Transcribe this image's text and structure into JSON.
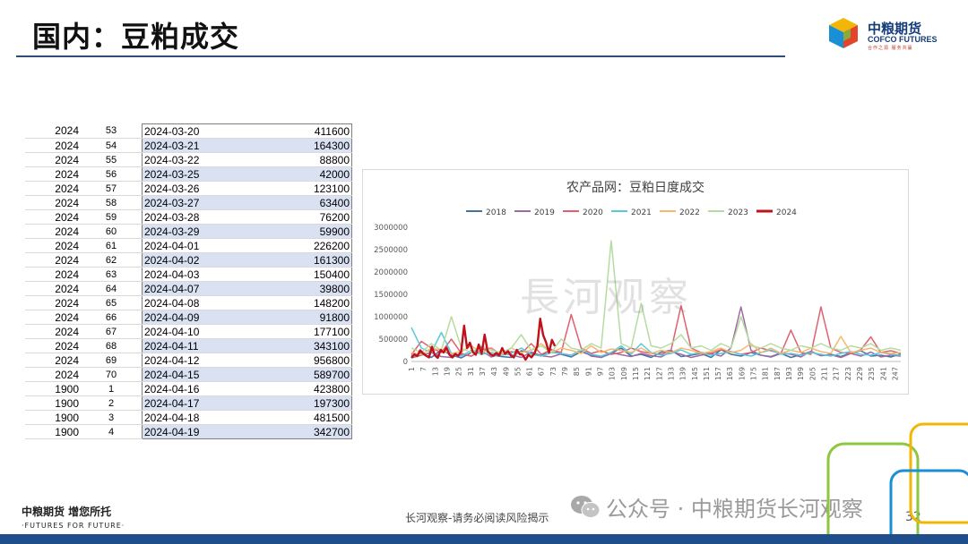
{
  "slide": {
    "title": "国内：豆粕成交",
    "page_number": "32"
  },
  "logo": {
    "cn": "中粮期货",
    "en": "COFCO FUTURES",
    "sub": "合作之源 服务共赢"
  },
  "table": {
    "rows": [
      [
        "2024",
        "53",
        "2024-03-20",
        "411600"
      ],
      [
        "2024",
        "54",
        "2024-03-21",
        "164300"
      ],
      [
        "2024",
        "55",
        "2024-03-22",
        "88800"
      ],
      [
        "2024",
        "56",
        "2024-03-25",
        "42000"
      ],
      [
        "2024",
        "57",
        "2024-03-26",
        "123100"
      ],
      [
        "2024",
        "58",
        "2024-03-27",
        "63400"
      ],
      [
        "2024",
        "59",
        "2024-03-28",
        "76200"
      ],
      [
        "2024",
        "60",
        "2024-03-29",
        "59900"
      ],
      [
        "2024",
        "61",
        "2024-04-01",
        "226200"
      ],
      [
        "2024",
        "62",
        "2024-04-02",
        "161300"
      ],
      [
        "2024",
        "63",
        "2024-04-03",
        "150400"
      ],
      [
        "2024",
        "64",
        "2024-04-07",
        "39800"
      ],
      [
        "2024",
        "65",
        "2024-04-08",
        "148200"
      ],
      [
        "2024",
        "66",
        "2024-04-09",
        "91800"
      ],
      [
        "2024",
        "67",
        "2024-04-10",
        "177100"
      ],
      [
        "2024",
        "68",
        "2024-04-11",
        "343100"
      ],
      [
        "2024",
        "69",
        "2024-04-12",
        "956800"
      ],
      [
        "2024",
        "70",
        "2024-04-15",
        "589700"
      ],
      [
        "1900",
        "1",
        "2024-04-16",
        "423800"
      ],
      [
        "1900",
        "2",
        "2024-04-17",
        "197300"
      ],
      [
        "1900",
        "3",
        "2024-04-18",
        "481500"
      ],
      [
        "1900",
        "4",
        "2024-04-19",
        "342700"
      ]
    ]
  },
  "chart_data": {
    "type": "line",
    "title": "农产品网：豆粕日度成交",
    "xlabel": "",
    "ylabel": "",
    "ylim": [
      0,
      3000000
    ],
    "yticks": [
      "0",
      "500000",
      "1000000",
      "1500000",
      "2000000",
      "2500000",
      "3000000"
    ],
    "xticks": [
      "1",
      "7",
      "13",
      "19",
      "25",
      "31",
      "37",
      "43",
      "49",
      "55",
      "61",
      "67",
      "73",
      "79",
      "85",
      "91",
      "97",
      "103",
      "109",
      "115",
      "121",
      "127",
      "133",
      "139",
      "145",
      "151",
      "157",
      "163",
      "169",
      "175",
      "181",
      "187",
      "193",
      "199",
      "205",
      "211",
      "217",
      "223",
      "229",
      "235",
      "241",
      "247"
    ],
    "legend_position": "top",
    "grid": false,
    "x_max": 250,
    "series": [
      {
        "name": "2018",
        "color": "#4472a0",
        "values": [
          120000,
          180000,
          90000,
          260000,
          140000,
          80000,
          200000,
          320000,
          150000,
          110000,
          90000,
          240000,
          180000,
          130000,
          270000,
          160000,
          100000,
          220000,
          140000,
          90000,
          180000,
          300000,
          120000,
          160000,
          90000,
          210000,
          250000,
          110000,
          140000,
          180000,
          90000,
          260000,
          160000,
          120000,
          200000,
          140000,
          100000,
          180000,
          90000,
          150000,
          220000,
          130000,
          160000,
          110000,
          190000,
          240000,
          120000,
          140000,
          100000,
          170000
        ]
      },
      {
        "name": "2019",
        "color": "#9e6b9e",
        "values": [
          80000,
          140000,
          200000,
          110000,
          90000,
          160000,
          120000,
          240000,
          100000,
          180000,
          150000,
          90000,
          210000,
          130000,
          100000,
          170000,
          140000,
          260000,
          120000,
          90000,
          200000,
          150000,
          110000,
          180000,
          130000,
          100000,
          220000,
          160000,
          90000,
          140000,
          180000,
          120000,
          300000,
          1220000,
          250000,
          140000,
          110000,
          190000,
          160000,
          100000,
          230000,
          130000,
          150000,
          90000,
          180000,
          120000,
          210000,
          100000,
          140000,
          120000
        ]
      },
      {
        "name": "2020",
        "color": "#e0606e",
        "values": [
          150000,
          450000,
          300000,
          200000,
          500000,
          180000,
          120000,
          260000,
          300000,
          150000,
          220000,
          180000,
          400000,
          160000,
          260000,
          200000,
          1050000,
          300000,
          180000,
          240000,
          160000,
          200000,
          300000,
          220000,
          180000,
          160000,
          250000,
          1250000,
          300000,
          200000,
          180000,
          260000,
          220000,
          160000,
          200000,
          300000,
          240000,
          180000,
          700000,
          200000,
          160000,
          1220000,
          300000,
          200000,
          180000,
          260000,
          550000,
          200000,
          240000,
          180000
        ]
      },
      {
        "name": "2021",
        "color": "#5ac8dc",
        "values": [
          760000,
          300000,
          200000,
          650000,
          180000,
          120000,
          250000,
          160000,
          200000,
          140000,
          180000,
          300000,
          160000,
          120000,
          200000,
          180000,
          140000,
          260000,
          160000,
          120000,
          200000,
          350000,
          160000,
          400000,
          200000,
          140000,
          180000,
          260000,
          160000,
          200000,
          140000,
          180000,
          220000,
          160000,
          120000,
          200000,
          260000,
          160000,
          180000,
          140000,
          200000,
          160000,
          120000,
          180000,
          220000,
          160000,
          140000,
          200000,
          160000,
          140000
        ]
      },
      {
        "name": "2022",
        "color": "#f5b86e",
        "values": [
          200000,
          150000,
          300000,
          250000,
          180000,
          220000,
          350000,
          200000,
          280000,
          150000,
          300000,
          200000,
          250000,
          400000,
          200000,
          300000,
          250000,
          180000,
          350000,
          200000,
          280000,
          250000,
          200000,
          300000,
          180000,
          250000,
          200000,
          300000,
          250000,
          180000,
          220000,
          300000,
          200000,
          250000,
          400000,
          200000,
          300000,
          180000,
          250000,
          200000,
          300000,
          220000,
          180000,
          560000,
          200000,
          250000,
          300000,
          200000,
          180000,
          200000
        ]
      },
      {
        "name": "2023",
        "color": "#b5dca0",
        "values": [
          300000,
          200000,
          400000,
          250000,
          1000000,
          300000,
          200000,
          350000,
          250000,
          200000,
          300000,
          600000,
          250000,
          350000,
          200000,
          500000,
          300000,
          250000,
          400000,
          300000,
          2700000,
          400000,
          300000,
          1300000,
          350000,
          300000,
          400000,
          600000,
          300000,
          350000,
          250000,
          400000,
          300000,
          1000000,
          350000,
          300000,
          400000,
          300000,
          250000,
          350000,
          300000,
          400000,
          300000,
          250000,
          350000,
          300000,
          400000,
          250000,
          300000,
          250000
        ]
      },
      {
        "name": "2024",
        "color": "#c0101a",
        "values": [
          80000,
          160000,
          120000,
          250000,
          180000,
          130000,
          90000,
          330000,
          140000,
          80000,
          260000,
          200000,
          310000,
          150000,
          90000,
          170000,
          130000,
          220000,
          800000,
          300000,
          420000,
          210000,
          150000,
          380000,
          170000,
          600000,
          240000,
          160000,
          130000,
          190000,
          140000,
          300000,
          170000,
          230000,
          130000,
          90000,
          260000,
          160000,
          150000,
          40000,
          150000,
          92000,
          177000,
          343000,
          957000,
          590000,
          424000,
          197000,
          481000,
          343000
        ]
      }
    ]
  },
  "watermark": "長河观察",
  "footer": {
    "slogan_cn": "中粮期货 增您所托",
    "slogan_en": "·FUTURES FOR FUTURE·",
    "disclaimer": "长河观察-请务必阅读风险揭示",
    "wechat": "公众号 · 中粮期货长河观察"
  },
  "colors": {
    "title_rule": "#2d4b7b",
    "table_shade": "#d9e1f2",
    "bottom_bar": "#1f4e8c"
  }
}
